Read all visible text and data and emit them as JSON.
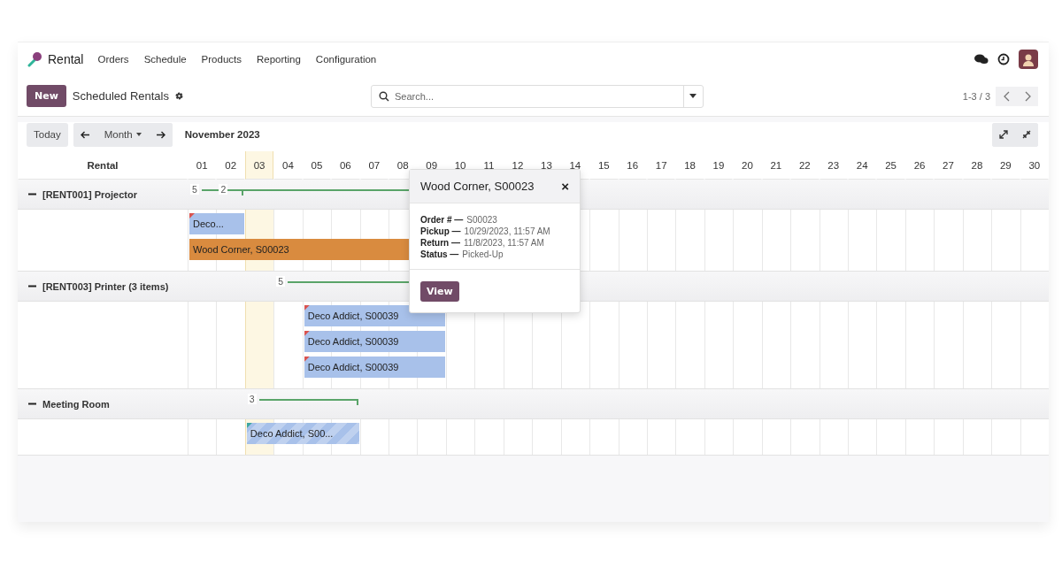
{
  "app": {
    "name": "Rental"
  },
  "menu": [
    "Orders",
    "Schedule",
    "Products",
    "Reporting",
    "Configuration"
  ],
  "control_panel": {
    "new_button": "New",
    "title": "Scheduled Rentals",
    "search_placeholder": "Search...",
    "pager": "1-3 / 3"
  },
  "gantt": {
    "today_button": "Today",
    "scale": "Month",
    "period": "November 2023",
    "row_header": "Rental",
    "days": [
      {
        "label": "01",
        "today": false
      },
      {
        "label": "02",
        "today": false
      },
      {
        "label": "03",
        "today": true
      },
      {
        "label": "04",
        "today": false
      },
      {
        "label": "05",
        "today": false
      },
      {
        "label": "06",
        "today": false
      },
      {
        "label": "07",
        "today": false
      },
      {
        "label": "08",
        "today": false
      },
      {
        "label": "09",
        "today": false
      },
      {
        "label": "10",
        "today": false
      },
      {
        "label": "11",
        "today": false
      },
      {
        "label": "12",
        "today": false
      },
      {
        "label": "13",
        "today": false
      },
      {
        "label": "14",
        "today": false
      },
      {
        "label": "15",
        "today": false
      },
      {
        "label": "16",
        "today": false
      },
      {
        "label": "17",
        "today": false
      },
      {
        "label": "18",
        "today": false
      },
      {
        "label": "19",
        "today": false
      },
      {
        "label": "20",
        "today": false
      },
      {
        "label": "21",
        "today": false
      },
      {
        "label": "22",
        "today": false
      },
      {
        "label": "23",
        "today": false
      },
      {
        "label": "24",
        "today": false
      },
      {
        "label": "25",
        "today": false
      },
      {
        "label": "26",
        "today": false
      },
      {
        "label": "27",
        "today": false
      },
      {
        "label": "28",
        "today": false
      },
      {
        "label": "29",
        "today": false
      },
      {
        "label": "30",
        "today": false
      }
    ],
    "groups": [
      {
        "title": "[RENT001] Projector",
        "expanded": true,
        "totals": [
          {
            "label": "5"
          },
          {
            "label": "2"
          }
        ],
        "lanes": [
          [
            {
              "label": "Deco...",
              "color": "#a8c1ea",
              "flag": {
                "color": "#d9534f"
              },
              "hatched": false
            }
          ],
          [
            {
              "label": "Wood Corner, S00023",
              "color": "#d98b3f",
              "hatched": false
            }
          ]
        ]
      },
      {
        "title": "[RENT003] Printer (3 items)",
        "expanded": true,
        "totals": [
          {
            "label": "5"
          }
        ],
        "lanes": [
          [
            {
              "label": "Deco Addict, S00039",
              "color": "#a8c1ea",
              "flag": {
                "color": "#d9534f"
              },
              "hatched": false
            }
          ],
          [
            {
              "label": "Deco Addict, S00039",
              "color": "#a8c1ea",
              "flag": {
                "color": "#d9534f"
              },
              "hatched": false
            }
          ],
          [
            {
              "label": "Deco Addict, S00039",
              "color": "#a8c1ea",
              "flag": {
                "color": "#d9534f"
              },
              "hatched": false
            }
          ]
        ]
      },
      {
        "title": "Meeting Room",
        "expanded": true,
        "totals": [
          {
            "label": "3"
          }
        ],
        "lanes": [
          [
            {
              "label": "Deco Addict, S00...",
              "color": "#a8c1ea",
              "flag": {
                "color": "#3fa7a0"
              },
              "hatched": true
            }
          ]
        ]
      }
    ]
  },
  "popover": {
    "title": "Wood Corner, S00023",
    "close": "×",
    "fields": [
      {
        "label": "Order # —",
        "value": "S00023"
      },
      {
        "label": "Pickup —",
        "value": "10/29/2023, 11:57 AM"
      },
      {
        "label": "Return —",
        "value": "11/8/2023, 11:57 AM"
      },
      {
        "label": "Status —",
        "value": "Picked-Up"
      }
    ],
    "button": "View"
  }
}
